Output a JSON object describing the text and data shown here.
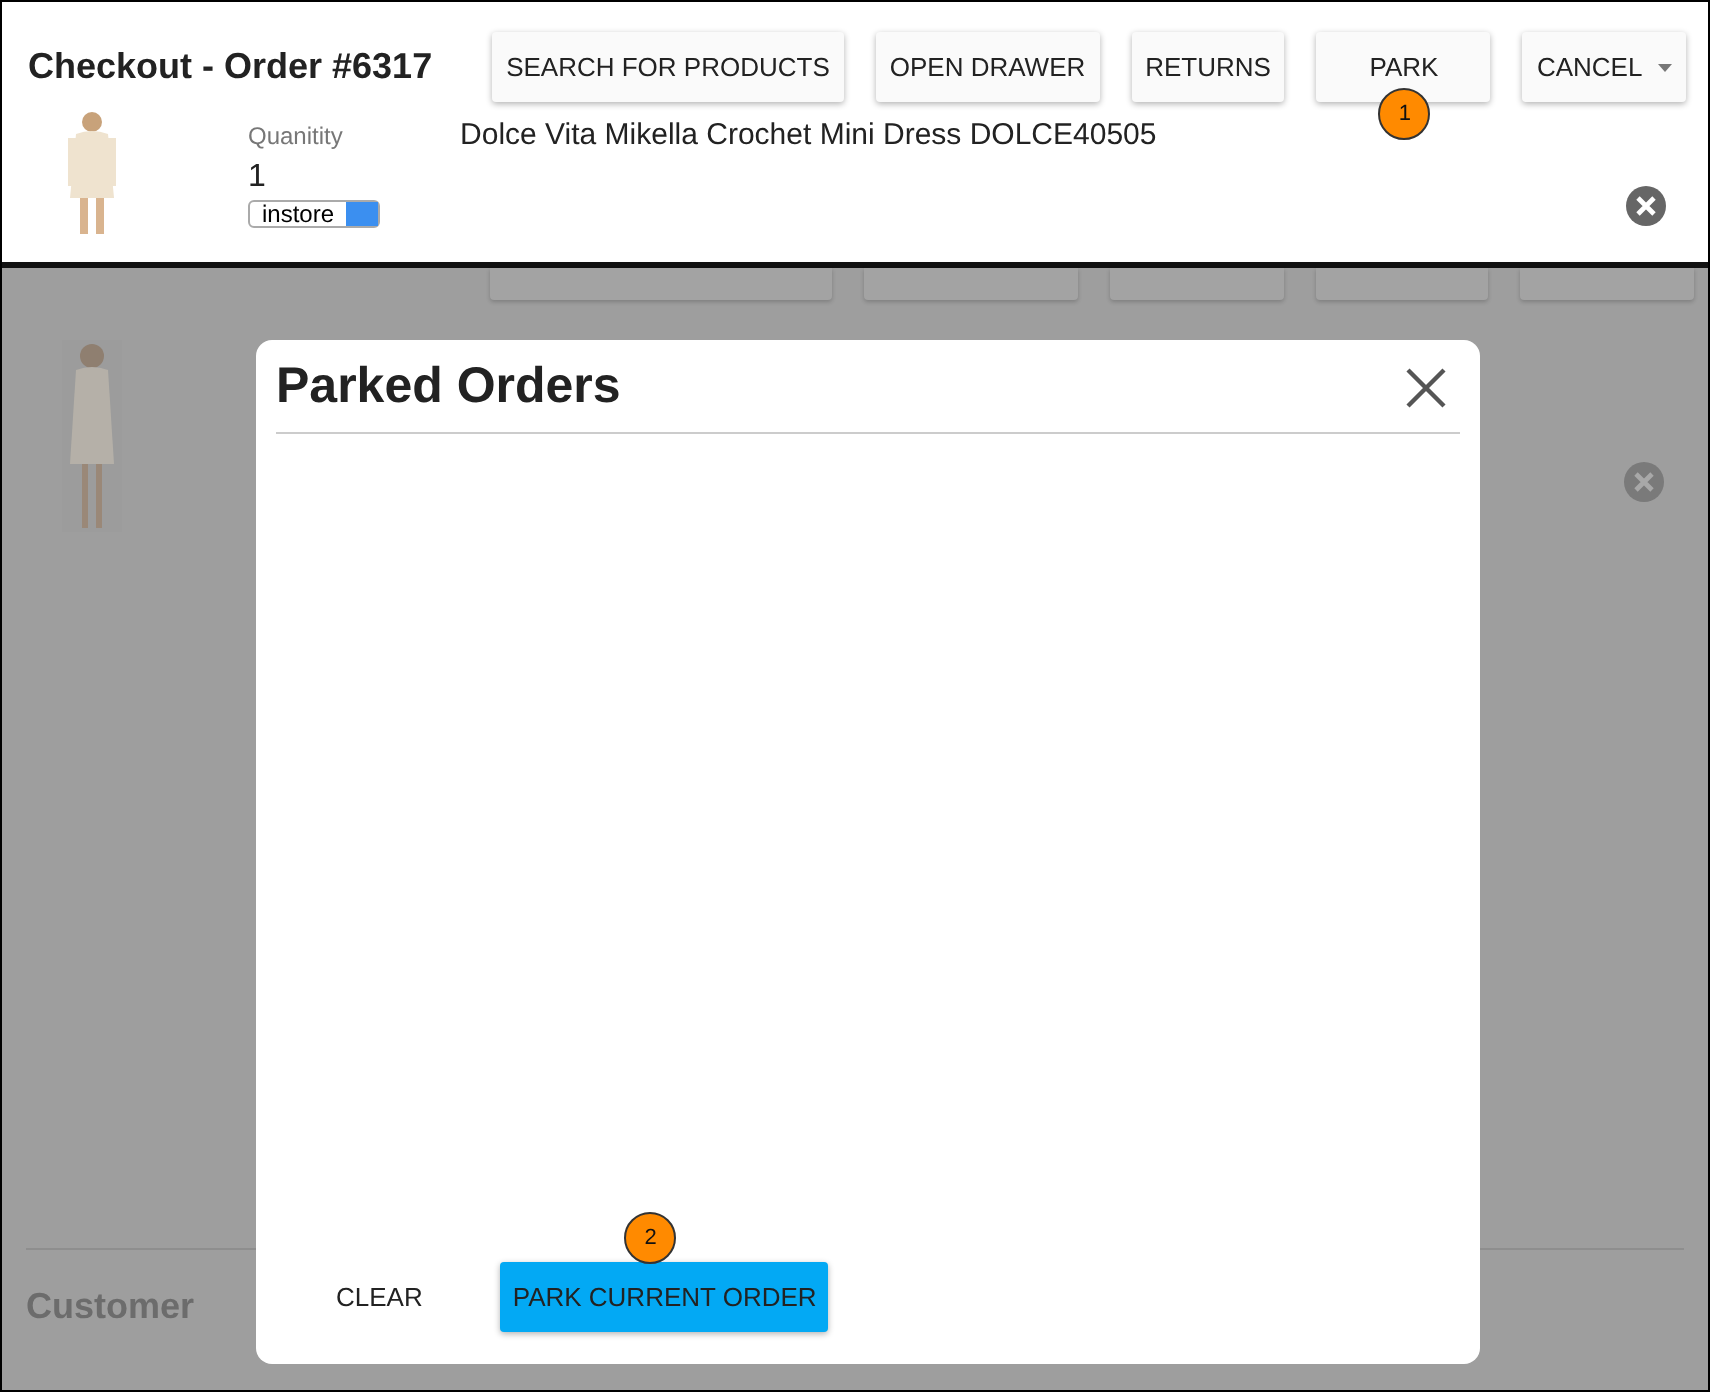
{
  "header": {
    "title": "Checkout - Order #6317",
    "buttons": [
      {
        "label": "SEARCH FOR PRODUCTS",
        "kind": "plain"
      },
      {
        "label": "OPEN DRAWER",
        "kind": "plain"
      },
      {
        "label": "RETURNS",
        "kind": "plain"
      },
      {
        "label": "PARK",
        "kind": "plain",
        "callout": "1"
      },
      {
        "label": "CANCEL",
        "kind": "dropdown"
      }
    ]
  },
  "line_item": {
    "quantity_label": "Quanitity",
    "quantity": "1",
    "location": "instore",
    "name": "Dolce Vita Mikella Crochet Mini Dress DOLCE40505"
  },
  "background": {
    "section": "Customer"
  },
  "modal": {
    "title": "Parked Orders",
    "actions": [
      {
        "label": "CLEAR",
        "kind": "text"
      },
      {
        "label": "PARK CURRENT ORDER",
        "kind": "primary",
        "callout": "2"
      }
    ]
  }
}
